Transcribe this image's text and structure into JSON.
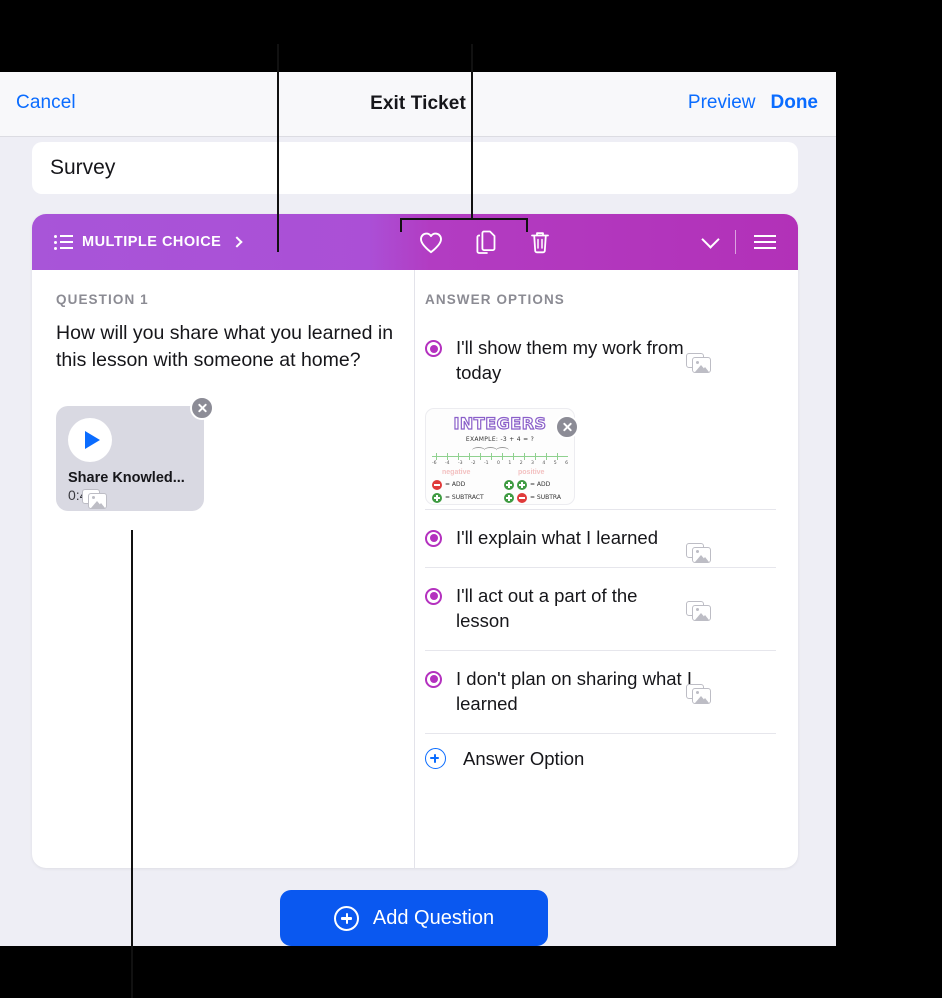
{
  "navbar": {
    "cancel_label": "Cancel",
    "title": "Exit Ticket",
    "preview_label": "Preview",
    "done_label": "Done"
  },
  "survey_field": {
    "value": "Survey"
  },
  "question_card": {
    "toolbar": {
      "type_label": "MULTIPLE CHOICE",
      "list_icon": "list-bullet-icon",
      "disclosure_icon": "chevron-right-icon",
      "favorite_icon": "heart-icon",
      "duplicate_icon": "duplicate-icon",
      "delete_icon": "trash-icon",
      "collapse_icon": "chevron-down-icon",
      "reorder_icon": "hamburger-icon"
    },
    "left_pane": {
      "section_label": "QUESTION 1",
      "question_text": "How will you share what you learned in this lesson with someone at home?",
      "video": {
        "play_icon": "play-icon",
        "title": "Share Knowled...",
        "duration": "0:42",
        "remove_icon": "close-icon"
      },
      "add_media_icon": "photo-stack-icon"
    },
    "right_pane": {
      "section_label": "ANSWER OPTIONS",
      "options": [
        {
          "text": "I'll show them my work from today",
          "selected": true,
          "media_icon": "photo-stack-icon"
        },
        {
          "text": "I'll explain what I learned",
          "selected": true,
          "media_icon": "photo-stack-icon"
        },
        {
          "text": "I'll act out a part of the lesson",
          "selected": true,
          "media_icon": "photo-stack-icon"
        },
        {
          "text": "I don't plan on sharing what I learned",
          "selected": true,
          "media_icon": "photo-stack-icon"
        }
      ],
      "attachment": {
        "title": "INTEGERS",
        "example": "EXAMPLE: -3 + 4 = ?",
        "tick_labels": [
          "-6",
          "-4",
          "-3",
          "-2",
          "-1",
          "0",
          "1",
          "2",
          "3",
          "4",
          "5",
          "6"
        ],
        "negative_label": "negative",
        "positive_label": "positive",
        "legend": [
          {
            "signs": [
              "minus"
            ],
            "label": "= ADD"
          },
          {
            "signs": [
              "plus"
            ],
            "label": "= SUBTRACT"
          },
          {
            "signs": [
              "plus",
              "plus"
            ],
            "label": "= ADD"
          },
          {
            "signs": [
              "plus",
              "minus"
            ],
            "label": "= SUBTRA"
          }
        ],
        "remove_icon": "close-icon"
      },
      "add_option": {
        "icon": "plus-circle-icon",
        "label": "Answer Option"
      }
    }
  },
  "add_question_button": {
    "icon": "plus-circle-icon",
    "label": "Add Question"
  },
  "colors": {
    "accent_blue": "#0a6cff",
    "button_blue": "#0a58f0",
    "toolbar_purple_start": "#a855d8",
    "toolbar_purple_end": "#b231b8",
    "radio_magenta": "#b431bf",
    "page_background": "#eeeef5"
  }
}
